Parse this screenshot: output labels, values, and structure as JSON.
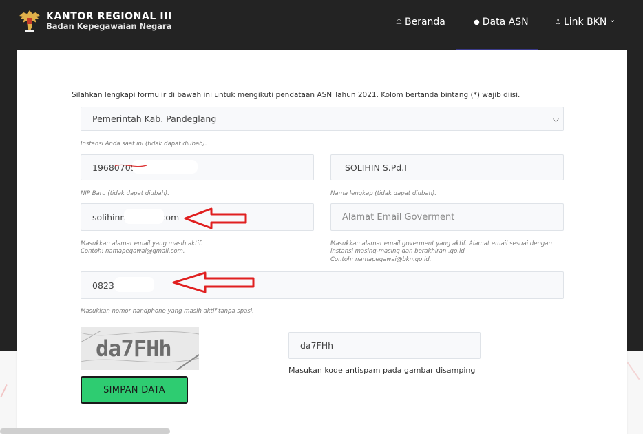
{
  "brand": {
    "title": "KANTOR REGIONAL III",
    "subtitle": "Badan Kepegawaian Negara"
  },
  "nav": [
    {
      "label": "Beranda",
      "icon": "home-icon"
    },
    {
      "label": "Data ASN",
      "icon": "user-icon"
    },
    {
      "label": "Link BKN",
      "icon": "anchor-icon"
    }
  ],
  "form": {
    "intro": "Silahkan lengkapi formulir di bawah ini untuk mengikuti pendataan ASN Tahun 2021. Kolom bertanda bintang (*) wajib diisi.",
    "instansi": {
      "value": "Pemerintah Kab. Pandeglang",
      "help": "Instansi Anda saat ini (tidak dapat diubah)."
    },
    "nip": {
      "value": "196807053",
      "help": "NIP Baru (tidak dapat diubah)."
    },
    "nama": {
      "value": "SOLIHIN S.Pd.I",
      "help": "Nama lengkap (tidak dapat diubah)."
    },
    "email": {
      "value": "solihinn@gmail.com",
      "help_1": "Masukkan alamat email yang masih aktif.",
      "help_2": "Contoh: namapegawai@gmail.com."
    },
    "email_gov": {
      "placeholder": "Alamat Email Goverment",
      "help_1": "Masukkan alamat email goverment yang aktif. Alamat email sesuai dengan",
      "help_2": "instansi masing-masing dan berakhiran .go.id",
      "help_3": "Contoh: namapegawai@bkn.go.id."
    },
    "phone": {
      "value": "0823",
      "help": "Masukkan nomor handphone yang masih aktif tanpa spasi."
    },
    "captcha": {
      "image_text": "da7FHh",
      "value": "da7FHh",
      "help": "Masukan kode antispam pada gambar disamping"
    },
    "submit_label": "SIMPAN DATA"
  },
  "colors": {
    "accent": "#2ecc71",
    "nav_bg": "#232323",
    "arrow": "#e02020"
  }
}
